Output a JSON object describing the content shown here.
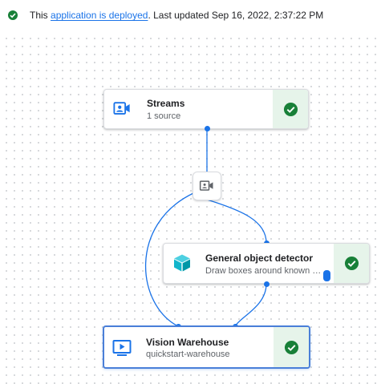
{
  "status": {
    "prefix": "This",
    "link_text": "application is deployed",
    "suffix": ". Last updated Sep 16, 2022, 2:37:22 PM"
  },
  "nodes": {
    "streams": {
      "title": "Streams",
      "subtitle": "1 source",
      "icon": "video-camera-icon",
      "status": "deployed"
    },
    "detector": {
      "title": "General object detector",
      "subtitle": "Draw boxes around known obj...",
      "icon": "cube-icon",
      "status": "deployed"
    },
    "warehouse": {
      "title": "Vision Warehouse",
      "subtitle": "quickstart-warehouse",
      "icon": "play-screen-icon",
      "status": "deployed"
    }
  },
  "connector": {
    "icon": "video-feed-icon"
  },
  "colors": {
    "accent": "#1a73e8",
    "success": "#188038",
    "success_bg": "#e6f4ea",
    "cube": "#12b5cb"
  }
}
